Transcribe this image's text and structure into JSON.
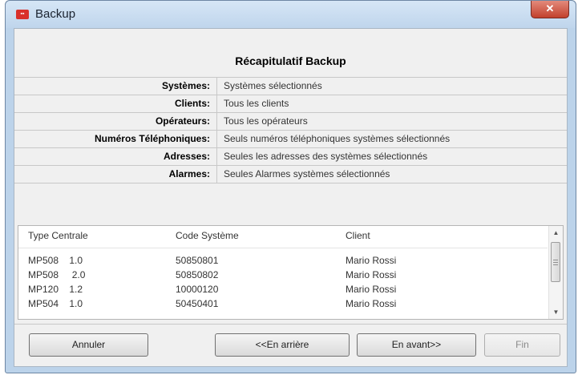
{
  "window": {
    "title": "Backup",
    "close_glyph": "✕"
  },
  "heading": "Récapitulatif Backup",
  "summary": [
    {
      "label": "Systèmes:",
      "value": "Systèmes sélectionnés"
    },
    {
      "label": "Clients:",
      "value": "Tous les clients"
    },
    {
      "label": "Opérateurs:",
      "value": "Tous les opérateurs"
    },
    {
      "label": "Numéros Téléphoniques:",
      "value": "Seuls numéros téléphoniques systèmes sélectionnés"
    },
    {
      "label": "Adresses:",
      "value": "Seules les adresses des systèmes sélectionnés"
    },
    {
      "label": "Alarmes:",
      "value": "Seules Alarmes systèmes sélectionnés"
    }
  ],
  "list": {
    "columns": [
      "Type Centrale",
      "Code Système",
      "Client"
    ],
    "rows": [
      [
        "MP508    1.0",
        "50850801",
        "Mario Rossi"
      ],
      [
        "MP508     2.0",
        "50850802",
        "Mario Rossi"
      ],
      [
        "MP120    1.2",
        "10000120",
        "Mario Rossi"
      ],
      [
        "MP504    1.0",
        "50450401",
        "Mario Rossi"
      ]
    ],
    "scroll_position": 0.1
  },
  "buttons": {
    "cancel": "Annuler",
    "back": "<<En arrière",
    "next": "En avant>>",
    "finish": "Fin",
    "finish_enabled": false
  },
  "colors": {
    "close_button": "#c2402c",
    "title_bar": "#bfd5ec"
  }
}
